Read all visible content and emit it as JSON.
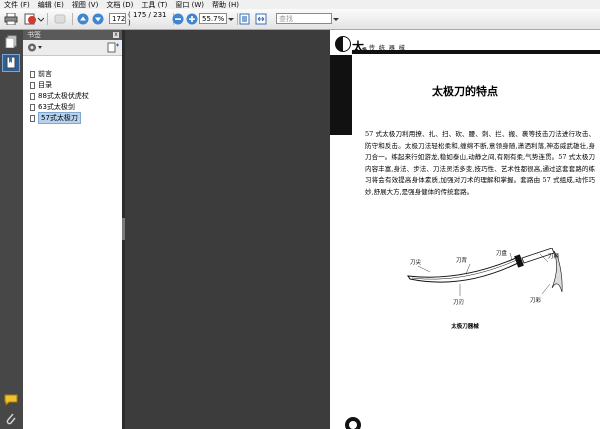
{
  "menubar": [
    "文件 (F)",
    "编辑 (E)",
    "视图 (V)",
    "文档 (D)",
    "工具 (T)",
    "窗口 (W)",
    "帮助 (H)"
  ],
  "toolbar": {
    "current_page": "172",
    "page_count_label": "( 175 / 231 )",
    "zoom": "55.7%",
    "search_placeholder": "查找"
  },
  "bookmarks": {
    "title": "书签",
    "close_label": "x",
    "items": [
      "前言",
      "目录",
      "88式太极伏虎杖",
      "63式太极剑",
      "57式太极刀"
    ],
    "selected_index": 4
  },
  "page": {
    "brand_char": "太",
    "brand_sub_char": "极",
    "brand_subtitle": "传 统 器 械",
    "title": "太极刀的特点",
    "body": "57 式太极刀利用撩、扎、扫、砍、腰、刺、拦、搬、裹等技击刀法进行攻击、防守和反击。太极刀法轻松柔和,缠绵不断,意领身随,潇洒利落,神态威武雄壮,身刀合一。练起来行如游龙,稳如泰山,动静之间,有刚有柔,气势连贯。57 式太极刀内容丰富,身法、步法、刀法灵活多变,技巧性、艺术性都很高,通过这套套路的练习将会有效提高身体素质,加强对刀术的理解和掌握。套路由 57 式组成,动作巧妙,舒展大方,是强身健体的传统套路。",
    "labels": {
      "dao_jian": "刀尖",
      "dao_bei": "刀背",
      "dao_pan": "刀盘",
      "dao_bing": "刀柄",
      "dao_ren": "刀刃",
      "dao_shao": "刀彩"
    },
    "caption": "太极刀器械"
  }
}
